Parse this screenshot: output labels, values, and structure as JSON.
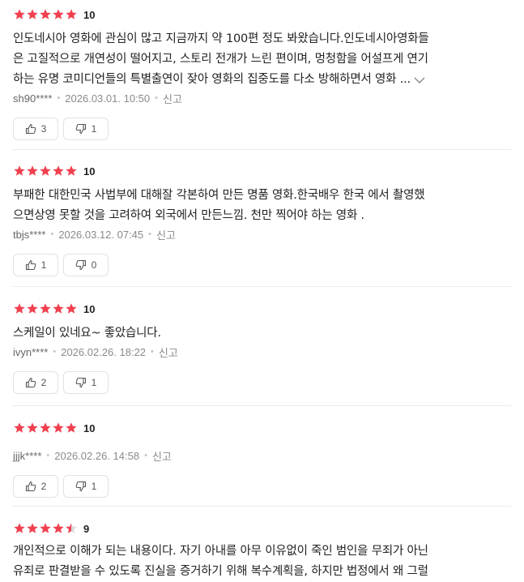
{
  "reviews": [
    {
      "stars": 5,
      "score": "10",
      "lines": [
        "인도네시아 영화에 관심이 많고 지금까지 약 100편 정도 봐왔습니다.인도네시아영화들",
        "은 고질적으로 개연성이 떨어지고, 스토리 전개가 느린 편이며, 멍청함을 어설프게 연기",
        "하는 유명 코미디언들의 특별출연이 잦아 영화의 집중도를 다소 방해하면서 영화 ..."
      ],
      "expandable": true,
      "user": "sh90****",
      "date": "2026.03.01. 10:50",
      "report": "신고",
      "likes": "3",
      "dislikes": "1"
    },
    {
      "stars": 5,
      "score": "10",
      "lines": [
        "부패한 대한민국 사법부에 대해잘 각본하여 만든 명품 영화.한국배우 한국 에서 촬영했",
        "으면상영 못할 것을 고려하여 외국에서 만든느낌. 천만 찍어야 하는 영화 ."
      ],
      "expandable": false,
      "user": "tbjs****",
      "date": "2026.03.12. 07:45",
      "report": "신고",
      "likes": "1",
      "dislikes": "0"
    },
    {
      "stars": 5,
      "score": "10",
      "lines": [
        "스케일이 있네요~ 좋았습니다."
      ],
      "expandable": false,
      "user": "ivyn****",
      "date": "2026.02.26. 18:22",
      "report": "신고",
      "likes": "2",
      "dislikes": "1"
    },
    {
      "stars": 5,
      "score": "10",
      "lines": [],
      "expandable": false,
      "user": "jjjk****",
      "date": "2026.02.26. 14:58",
      "report": "신고",
      "likes": "2",
      "dislikes": "1"
    },
    {
      "stars": 4.5,
      "score": "9",
      "lines": [
        "개인적으로 이해가 되는 내용이다. 자기 아내를 아무 이유없이 죽인 범인을 무죄가 아닌",
        "유죄로 판결받을 수 있도록 진실을 증거하기 위해 복수계획을, 하지만 법정에서 왜 그럴"
      ],
      "expandable": false,
      "user": "",
      "date": "",
      "report": "",
      "likes": "",
      "dislikes": ""
    }
  ],
  "colors": {
    "star": "#f0404f",
    "star_empty": "#d9d9d9"
  },
  "icons": {
    "like": "thumbs-up-icon",
    "dislike": "thumbs-down-icon",
    "expand": "chevron-down-icon"
  }
}
